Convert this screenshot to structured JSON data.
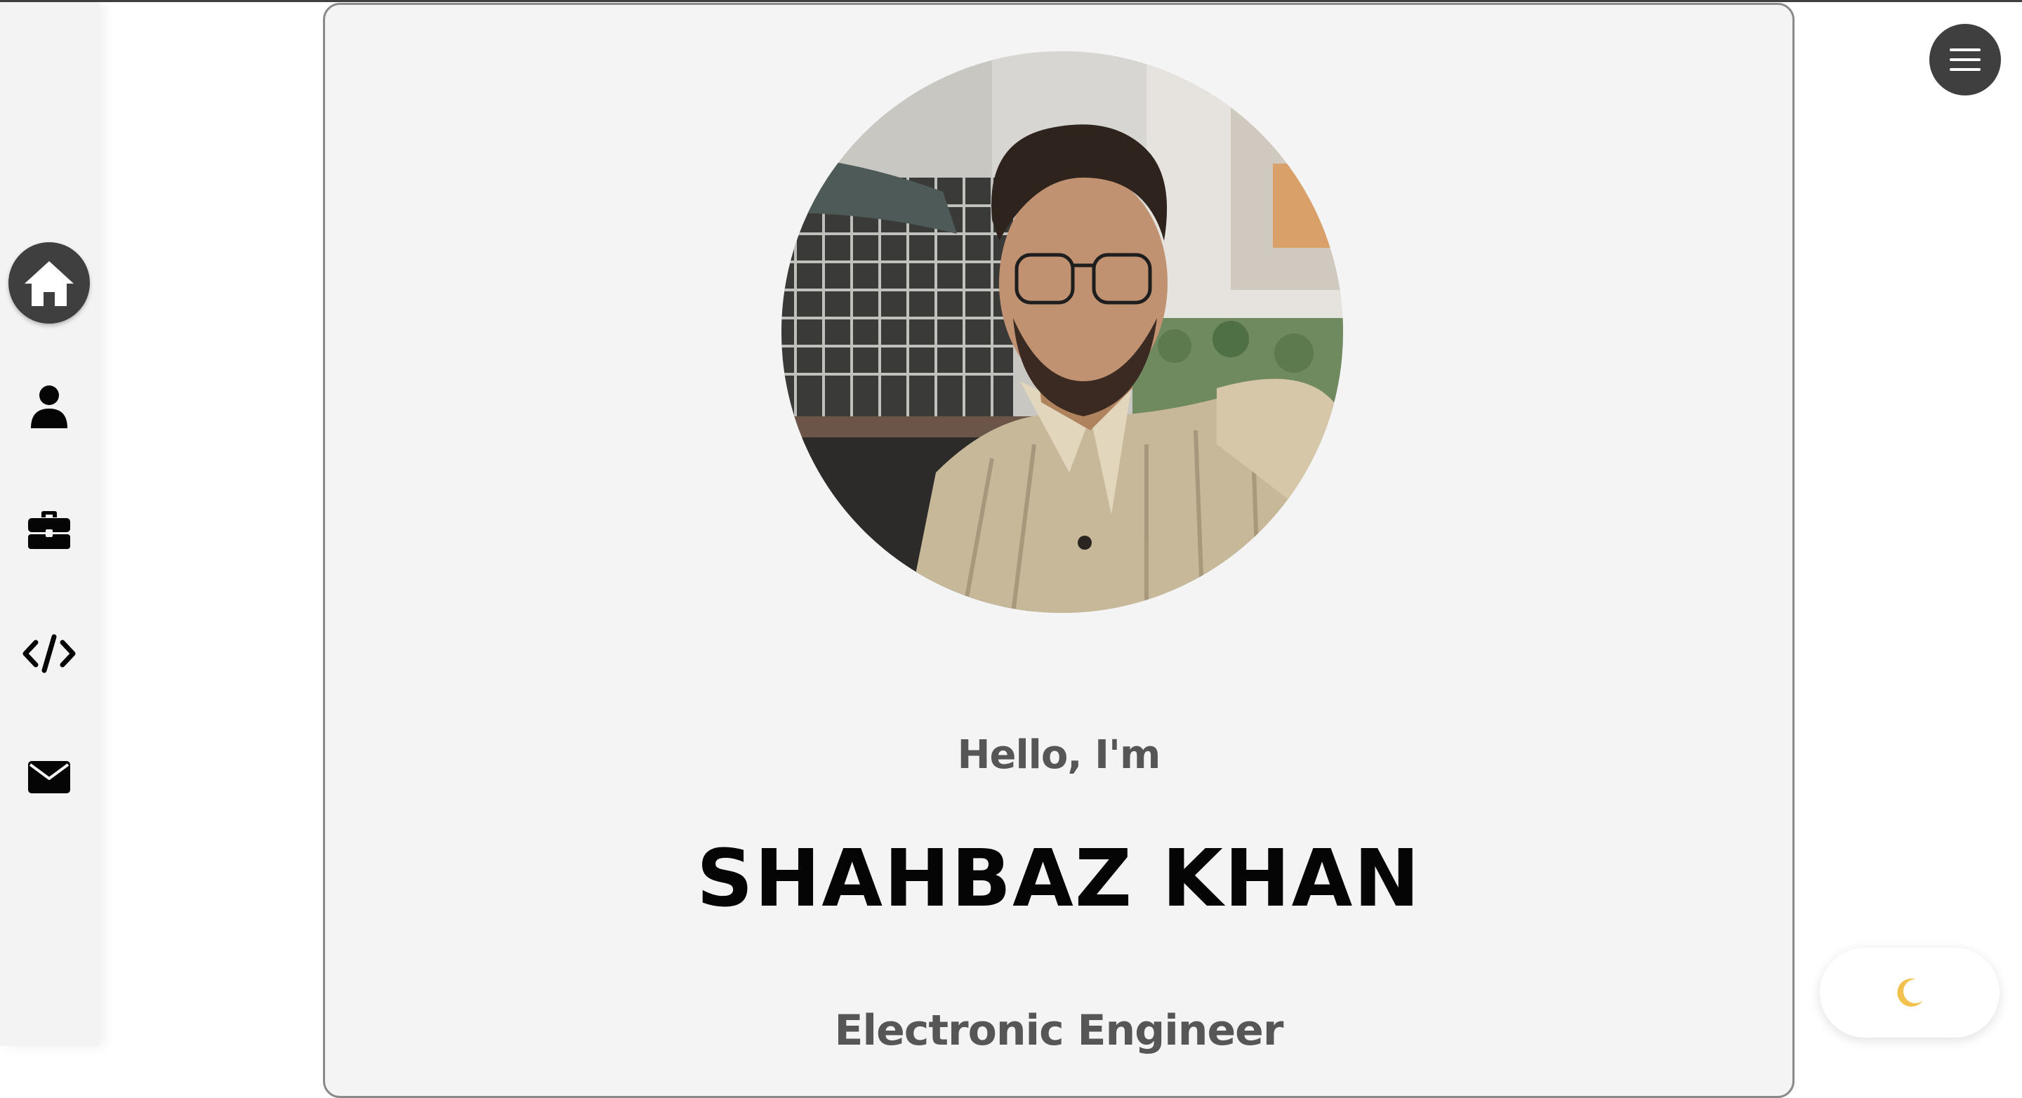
{
  "sidebar": {
    "items": [
      {
        "name": "home",
        "icon": "home-icon",
        "active": true
      },
      {
        "name": "about",
        "icon": "user-icon",
        "active": false
      },
      {
        "name": "experience",
        "icon": "briefcase-icon",
        "active": false
      },
      {
        "name": "projects",
        "icon": "code-icon",
        "active": false
      },
      {
        "name": "contact",
        "icon": "envelope-icon",
        "active": false
      }
    ]
  },
  "hero": {
    "greeting": "Hello, I'm",
    "name": "SHAHBAZ KHAN",
    "role": "Electronic Engineer",
    "photo_alt": "profile-photo"
  },
  "header": {
    "menu_icon": "hamburger-menu-icon"
  },
  "theme_toggle": {
    "icon": "moon-icon"
  },
  "colors": {
    "accent_dark": "#3f3f3f",
    "card_bg": "#f4f4f4",
    "sidebar_bg": "#f3f3f3",
    "text_primary": "#050505",
    "text_secondary": "#565656"
  }
}
